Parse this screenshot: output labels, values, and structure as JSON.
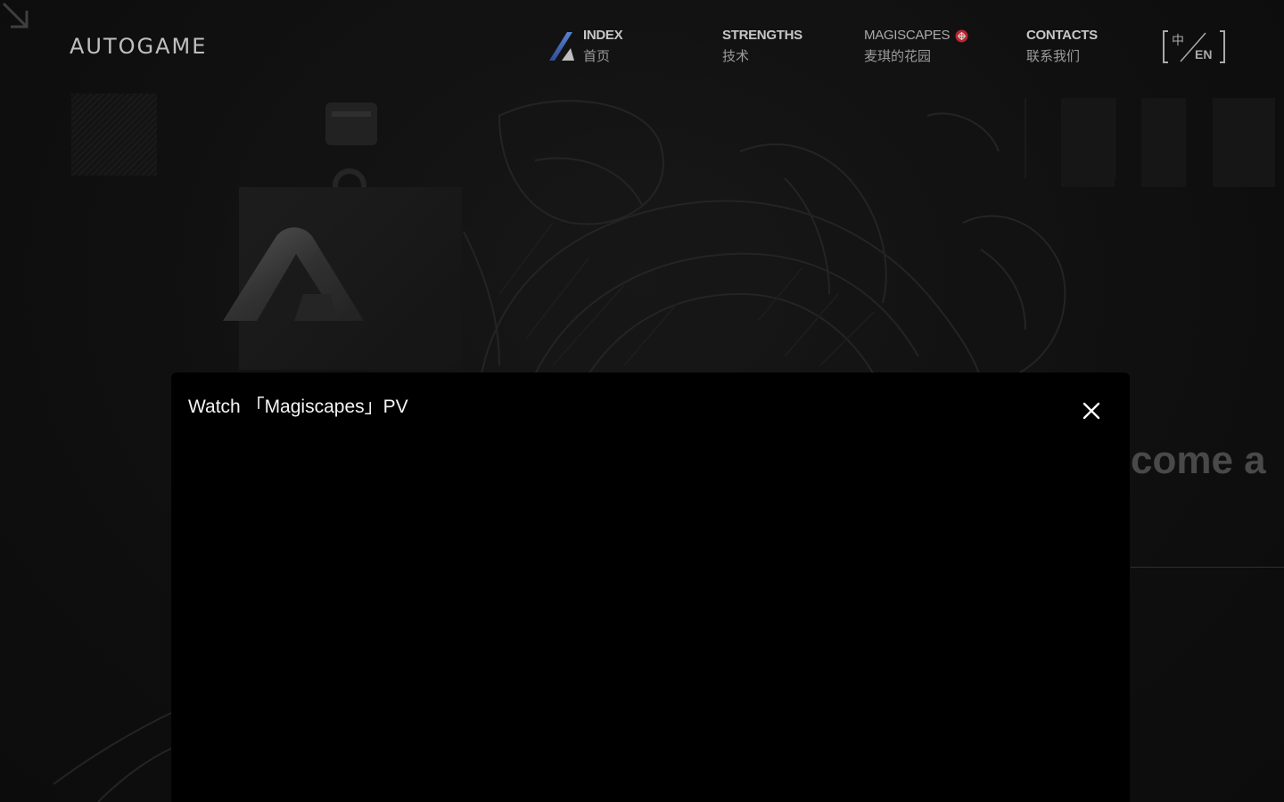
{
  "header": {
    "logo_text": "AUTOGAME",
    "nav": [
      {
        "en": "INDEX",
        "cn": "首页",
        "active": true
      },
      {
        "en": "STRENGTHS",
        "cn": "技术"
      },
      {
        "en": "MAGISCAPES",
        "cn": "麦琪的花园",
        "badge": "new-badge-icon"
      },
      {
        "en": "CONTACTS",
        "cn": "联系我们"
      }
    ],
    "lang_switch": {
      "zh": "中",
      "en": "EN"
    }
  },
  "background": {
    "welcome_fragment": "come a"
  },
  "modal": {
    "title": "Watch 「Magiscapes」PV",
    "close_icon": "close-icon"
  },
  "colors": {
    "accent_blue": "#4a7bd8",
    "badge_red": "#e0303a",
    "background": "#121212"
  }
}
